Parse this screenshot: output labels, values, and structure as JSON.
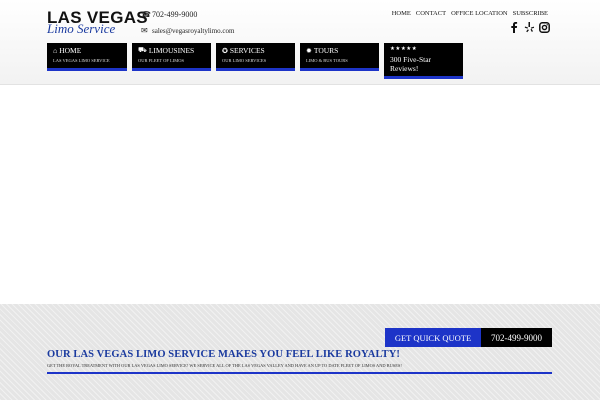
{
  "logo": {
    "line1": "LAS VEGAS",
    "line2": "Limo Service"
  },
  "contact": {
    "phone": "702-499-9000",
    "email": "sales@vegasroyaltylimo.com"
  },
  "top_nav": [
    "HOME",
    "CONTACT",
    "OFFICE LOCATION",
    "SUBSCRIBE"
  ],
  "social": [
    "facebook-icon",
    "yelp-icon",
    "instagram-icon"
  ],
  "main_nav": [
    {
      "icon": "home-icon",
      "glyph": "⌂",
      "label": "HOME",
      "sub": "LAS VEGAS LIMO SERVICE"
    },
    {
      "icon": "car-icon",
      "glyph": "⛟",
      "label": "LIMOUSINES",
      "sub": "OUR FLEET OF LIMOS"
    },
    {
      "icon": "star-circle-icon",
      "glyph": "✪",
      "label": "SERVICES",
      "sub": "OUR LIMO SERVICES"
    },
    {
      "icon": "gear-icon",
      "glyph": "✹",
      "label": "TOURS",
      "sub": "LIMO & BUS TOURS"
    }
  ],
  "reviews": {
    "stars": "★★★★★",
    "text": "300 Five-Star Reviews!",
    "rating": 5
  },
  "cta": {
    "quote_label": "GET QUICK QUOTE",
    "phone": "702-499-9000",
    "headline": "OUR LAS VEGAS LIMO SERVICE MAKES YOU FEEL LIKE ROYALTY!",
    "tagline": "GET THE ROYAL TREATMENT WITH OUR LAS VEGAS LIMO SERVICE! WE SERVICE ALL OF THE LAS VEGAS VALLEY AND HAVE AN UP TO DATE FLEET OF LIMOS AND BUSES!"
  },
  "colors": {
    "accent": "#1d34c8",
    "brand_blue": "#1a3a9f",
    "nav_bg": "#000000"
  }
}
